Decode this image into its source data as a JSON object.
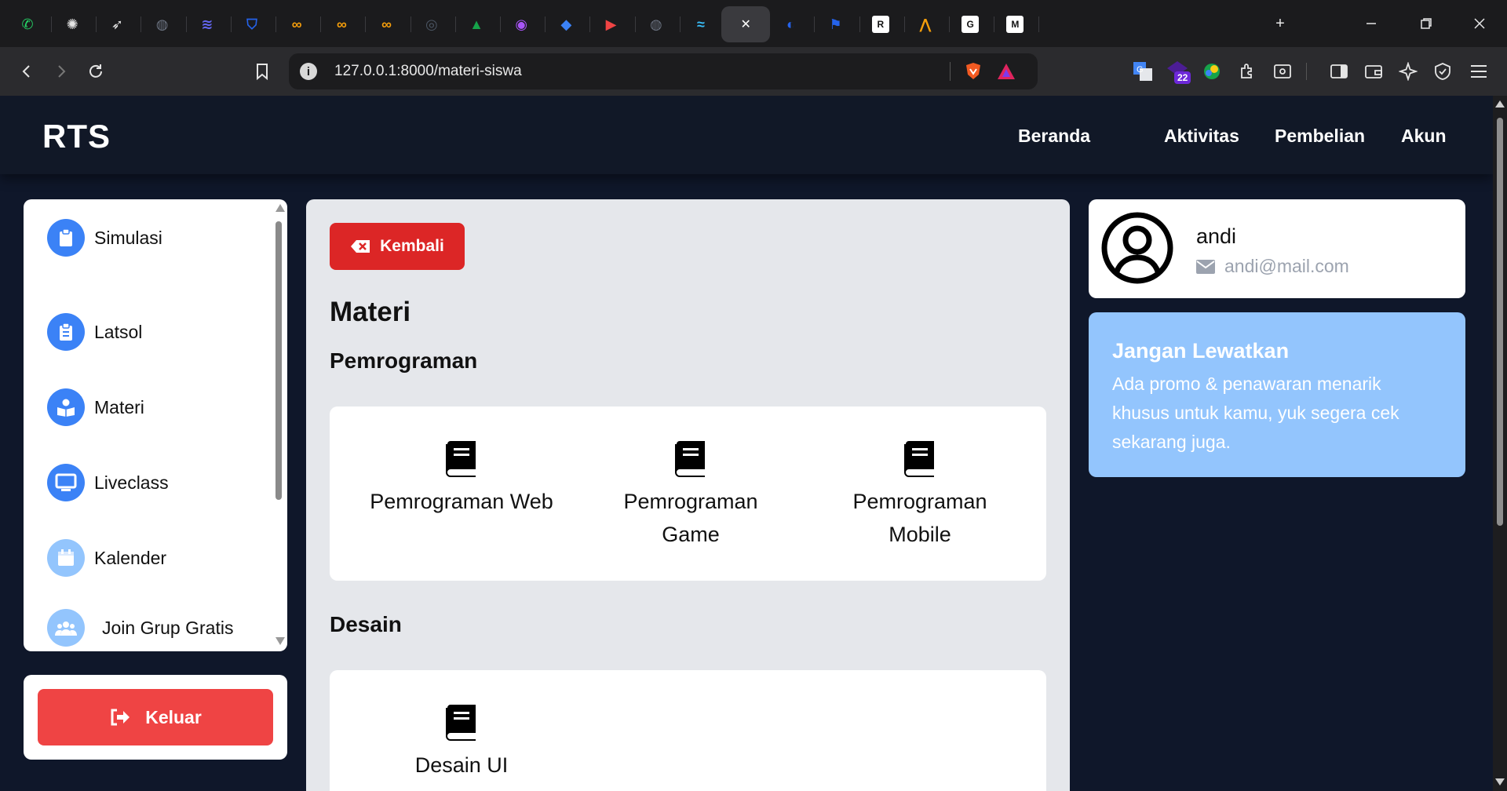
{
  "browser": {
    "tabs": [
      {
        "icon": "whatsapp-icon",
        "color": "#25d366",
        "glyph": "✆"
      },
      {
        "icon": "chatgpt-icon",
        "color": "#1b1b1d",
        "glyph": "✺"
      },
      {
        "icon": "feather-icon",
        "color": "#1b1b1d",
        "glyph": "➶"
      },
      {
        "icon": "globe-icon",
        "color": "#6b7280",
        "glyph": "◍"
      },
      {
        "icon": "codeium-icon",
        "color": "#6366f1",
        "glyph": "≋"
      },
      {
        "icon": "shield-icon",
        "color": "#2563eb",
        "glyph": "⛉"
      },
      {
        "icon": "infinity-icon",
        "color": "#f59e0b",
        "glyph": "∞"
      },
      {
        "icon": "infinity-icon",
        "color": "#f59e0b",
        "glyph": "∞"
      },
      {
        "icon": "infinity-icon",
        "color": "#f59e0b",
        "glyph": "∞"
      },
      {
        "icon": "openai-icon",
        "color": "#4b5563",
        "glyph": "◎"
      },
      {
        "icon": "google-drive-icon",
        "color": "#16a34a",
        "glyph": "▲"
      },
      {
        "icon": "copilot-icon",
        "color": "#a855f7",
        "glyph": "◉"
      },
      {
        "icon": "graduation-cap-icon",
        "color": "#3b82f6",
        "glyph": "◆"
      },
      {
        "icon": "youtube-icon",
        "color": "#ef4444",
        "glyph": "▶"
      },
      {
        "icon": "globe-icon",
        "color": "#6b7280",
        "glyph": "◍"
      },
      {
        "icon": "tailwind-icon",
        "color": "#38bdf8",
        "glyph": "≈"
      },
      {
        "icon": "close-icon",
        "color": "#3a3a3e",
        "glyph": "✕",
        "active": true
      },
      {
        "icon": "edge-icon",
        "color": "#2563eb",
        "glyph": "◐"
      },
      {
        "icon": "flag-icon",
        "color": "#2563eb",
        "glyph": "⚑"
      },
      {
        "icon": "researchgate-icon",
        "color": "#ffffff",
        "glyph": "R"
      },
      {
        "icon": "mountain-icon",
        "color": "#f59e0b",
        "glyph": "⋀"
      },
      {
        "icon": "google-icon",
        "color": "#ffffff",
        "glyph": "G"
      },
      {
        "icon": "medium-icon",
        "color": "#ffffff",
        "glyph": "M"
      }
    ],
    "new_tab": "+",
    "url": "127.0.0.1:8000/materi-siswa",
    "extension_badge": "22"
  },
  "navbar": {
    "brand": "RTS",
    "links": [
      "Beranda",
      "Aktivitas",
      "Pembelian",
      "Akun"
    ]
  },
  "sidebar": {
    "items": [
      {
        "label": "Simulasi",
        "icon": "clipboard-icon"
      },
      {
        "label": "Latsol",
        "icon": "clipboard-list-icon"
      },
      {
        "label": "Materi",
        "icon": "book-reader-icon"
      },
      {
        "label": "Liveclass",
        "icon": "monitor-icon"
      },
      {
        "label": "Kalender",
        "icon": "calendar-icon"
      },
      {
        "label": "Join Grup Gratis",
        "icon": "users-icon"
      }
    ],
    "logout_label": "Keluar"
  },
  "main": {
    "back_label": "Kembali",
    "title": "Materi",
    "sections": [
      {
        "title": "Pemrograman",
        "items": [
          "Pemrograman Web",
          "Pemrograman Game",
          "Pemrograman Mobile"
        ]
      },
      {
        "title": "Desain",
        "items": [
          "Desain UI"
        ]
      }
    ]
  },
  "profile": {
    "name": "andi",
    "email": "andi@mail.com"
  },
  "promo": {
    "title": "Jangan Lewatkan",
    "text": "Ada promo & penawaran menarik khusus untuk kamu, yuk segera cek sekarang juga."
  },
  "colors": {
    "page_bg": "#0f172a",
    "navbar_bg": "#111827",
    "accent_blue": "#3b82f6",
    "promo_bg": "#93c5fd",
    "danger": "#ef4444"
  }
}
